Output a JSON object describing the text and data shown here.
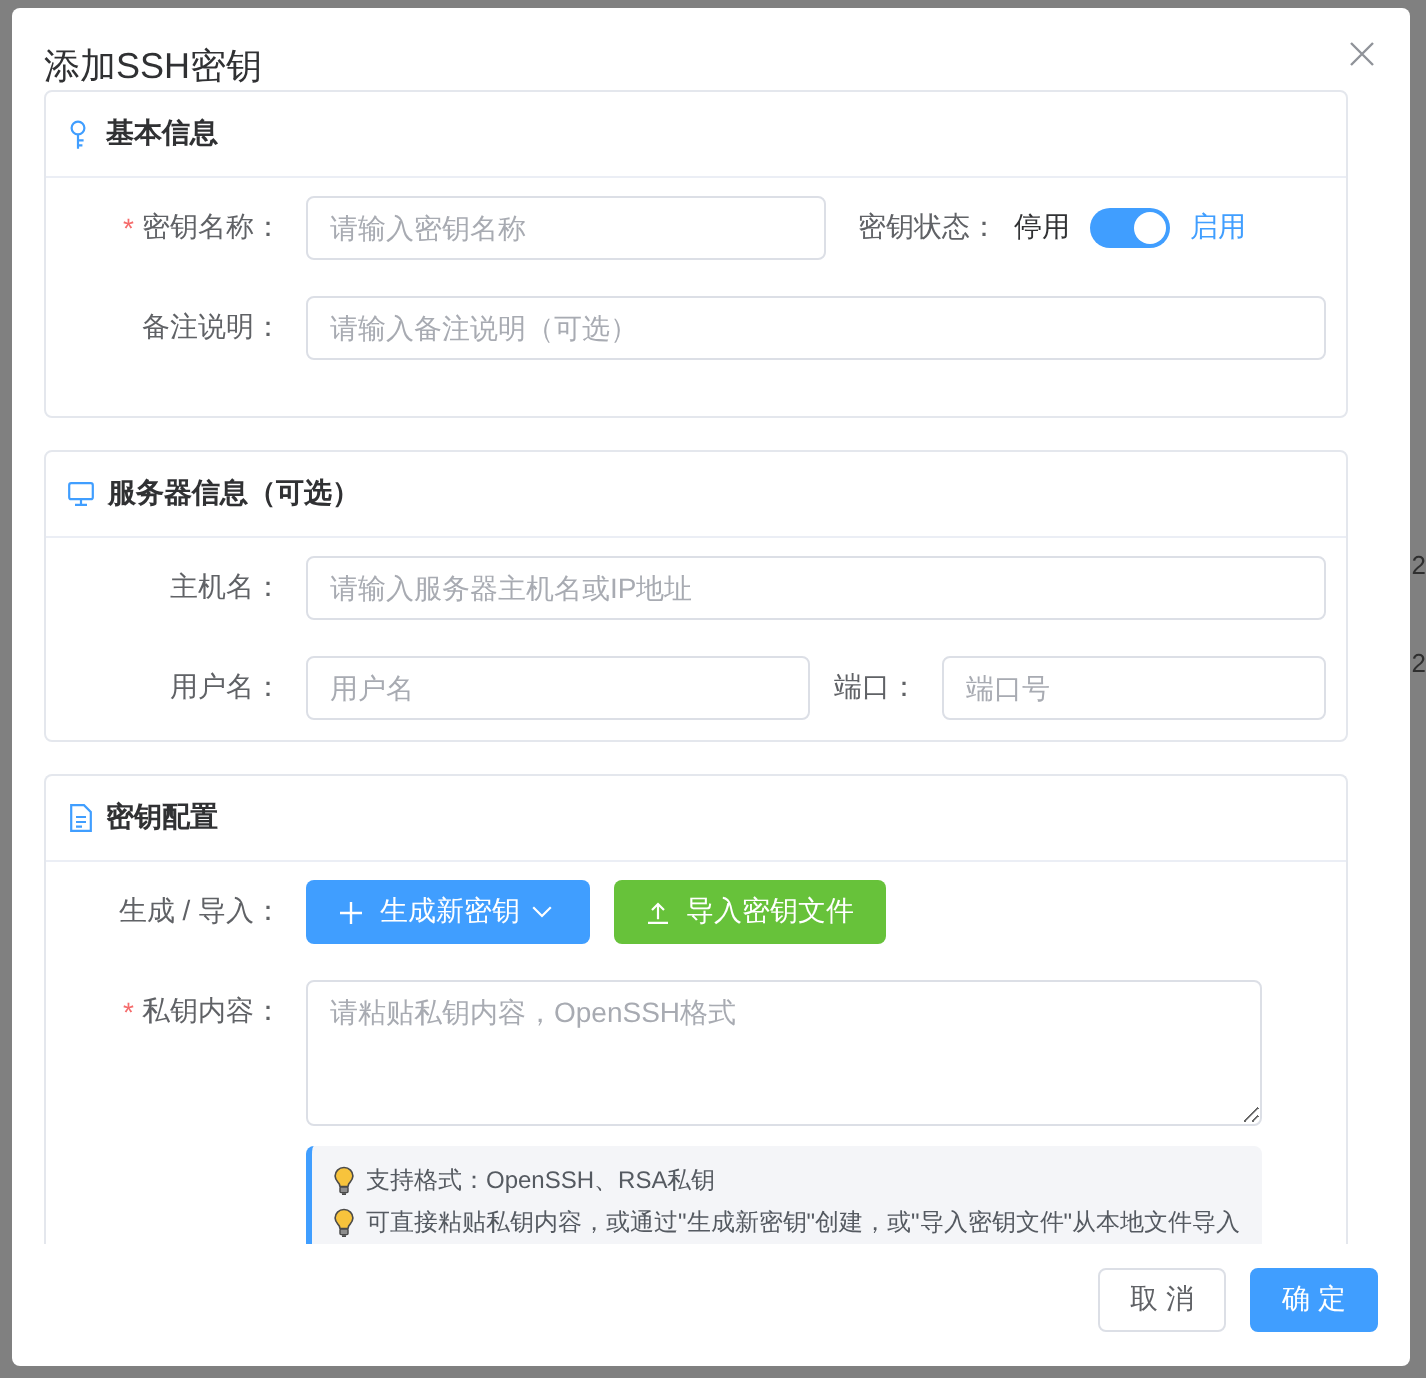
{
  "backdrop": {
    "cells": [
      "2",
      "2"
    ]
  },
  "dialog": {
    "title": "添加SSH密钥"
  },
  "basic_info": {
    "title": "基本信息",
    "key_name": {
      "required_mark": "*",
      "label": "密钥名称：",
      "placeholder": "请输入密钥名称"
    },
    "status": {
      "label": "密钥状态：",
      "off_text": "停用",
      "on_text": "启用",
      "on": true
    },
    "remark": {
      "label": "备注说明：",
      "placeholder": "请输入备注说明（可选）"
    }
  },
  "server_info": {
    "title": "服务器信息（可选）",
    "host": {
      "label": "主机名：",
      "placeholder": "请输入服务器主机名或IP地址"
    },
    "username": {
      "label": "用户名：",
      "placeholder": "用户名"
    },
    "port": {
      "label": "端口：",
      "placeholder": "端口号"
    }
  },
  "key_config": {
    "title": "密钥配置",
    "source": {
      "label": "生成 / 导入：",
      "generate_button": "生成新密钥",
      "import_button": "导入密钥文件"
    },
    "private_key": {
      "required_mark": "*",
      "label": "私钥内容：",
      "placeholder": "请粘贴私钥内容，OpenSSH格式"
    },
    "tips": [
      "支持格式：OpenSSH、RSA私钥",
      "可直接粘贴私钥内容，或通过\"生成新密钥\"创建，或\"导入密钥文件\"从本地文件导入"
    ]
  },
  "footer": {
    "buttons": [
      {
        "label": "取 消",
        "kind": "default"
      },
      {
        "label": "确 定",
        "kind": "primary"
      }
    ]
  }
}
